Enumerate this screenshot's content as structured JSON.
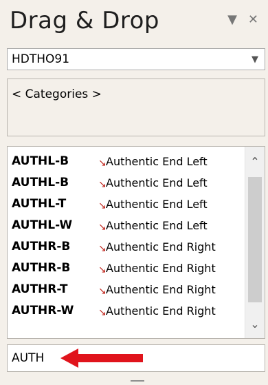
{
  "panel": {
    "title": "Drag & Drop",
    "pin_icon": "chevron-down-icon",
    "close_icon": "close-icon"
  },
  "combo": {
    "selected": "HDTHO91",
    "dropdown_icon": "chevron-down-icon"
  },
  "categories": {
    "label": "< Categories >"
  },
  "list": {
    "items": [
      {
        "code": "AUTHL-B",
        "desc": "Authentic End Left"
      },
      {
        "code": "AUTHL-B",
        "desc": "Authentic End Left"
      },
      {
        "code": "AUTHL-T",
        "desc": "Authentic End Left"
      },
      {
        "code": "AUTHL-W",
        "desc": "Authentic End Left"
      },
      {
        "code": "AUTHR-B",
        "desc": "Authentic End Right"
      },
      {
        "code": "AUTHR-B",
        "desc": "Authentic End Right"
      },
      {
        "code": "AUTHR-T",
        "desc": "Authentic End Right"
      },
      {
        "code": "AUTHR-W",
        "desc": "Authentic End Right"
      }
    ],
    "scroll_up_icon": "chevron-up-icon",
    "scroll_down_icon": "chevron-down-icon"
  },
  "search": {
    "value": "AUTH"
  },
  "colors": {
    "annotation_arrow": "#e0141c",
    "item_marker": "#c0281f"
  }
}
